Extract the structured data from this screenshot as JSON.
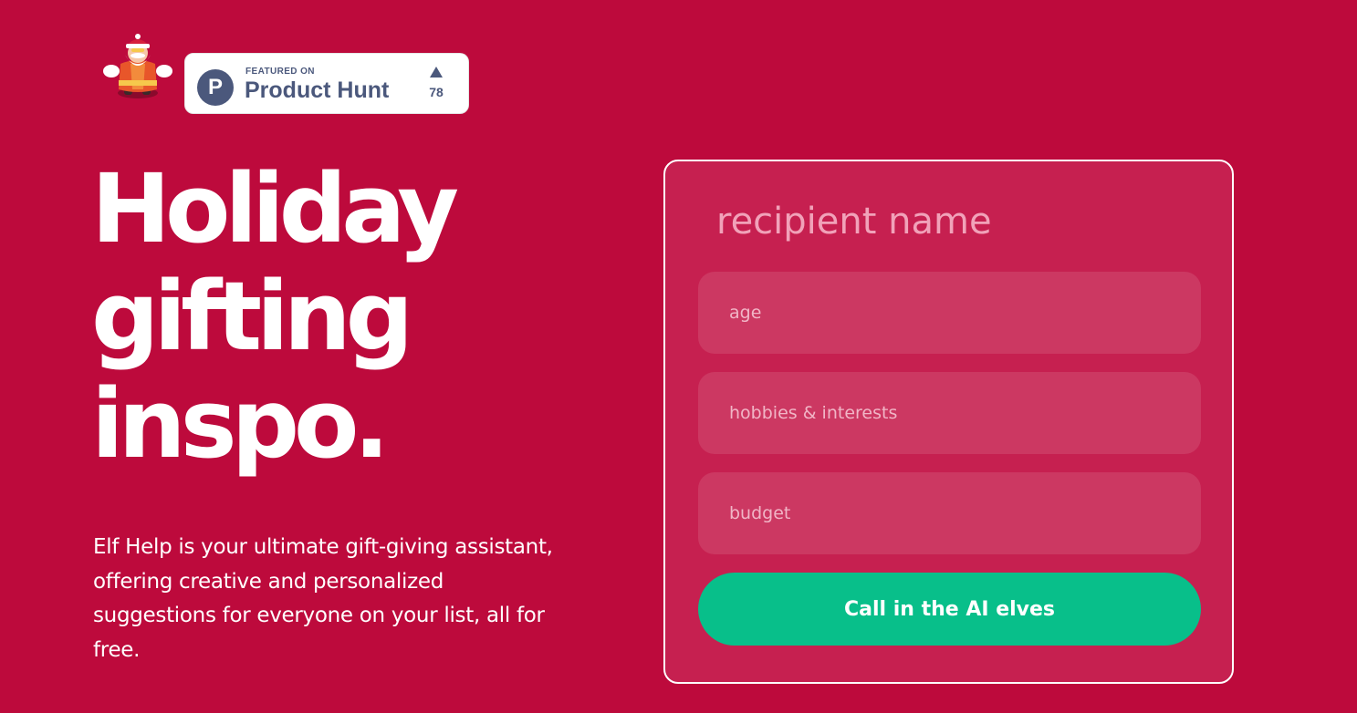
{
  "colors": {
    "background": "#bd0a3c",
    "card": "#c62050",
    "field": "#cc3862",
    "cta": "#08bf8a",
    "product_hunt": "#4b587c"
  },
  "logo": {
    "icon": "santa-elf-mascot-icon"
  },
  "product_hunt_badge": {
    "icon": "product-hunt-logo-icon",
    "letter": "P",
    "featured_label": "FEATURED ON",
    "name": "Product Hunt",
    "upvote_icon": "triangle-up-icon",
    "upvotes": "78"
  },
  "hero": {
    "headline_lines": [
      "Holiday",
      "gifting",
      "inspo."
    ],
    "description": "Elf Help is your ultimate gift-giving assistant, offering creative and personalized suggestions for everyone on your list, all for free."
  },
  "form": {
    "name_placeholder": "recipient name",
    "age_placeholder": "age",
    "hobbies_placeholder": "hobbies & interests",
    "budget_placeholder": "budget",
    "submit_label": "Call in the AI elves"
  }
}
